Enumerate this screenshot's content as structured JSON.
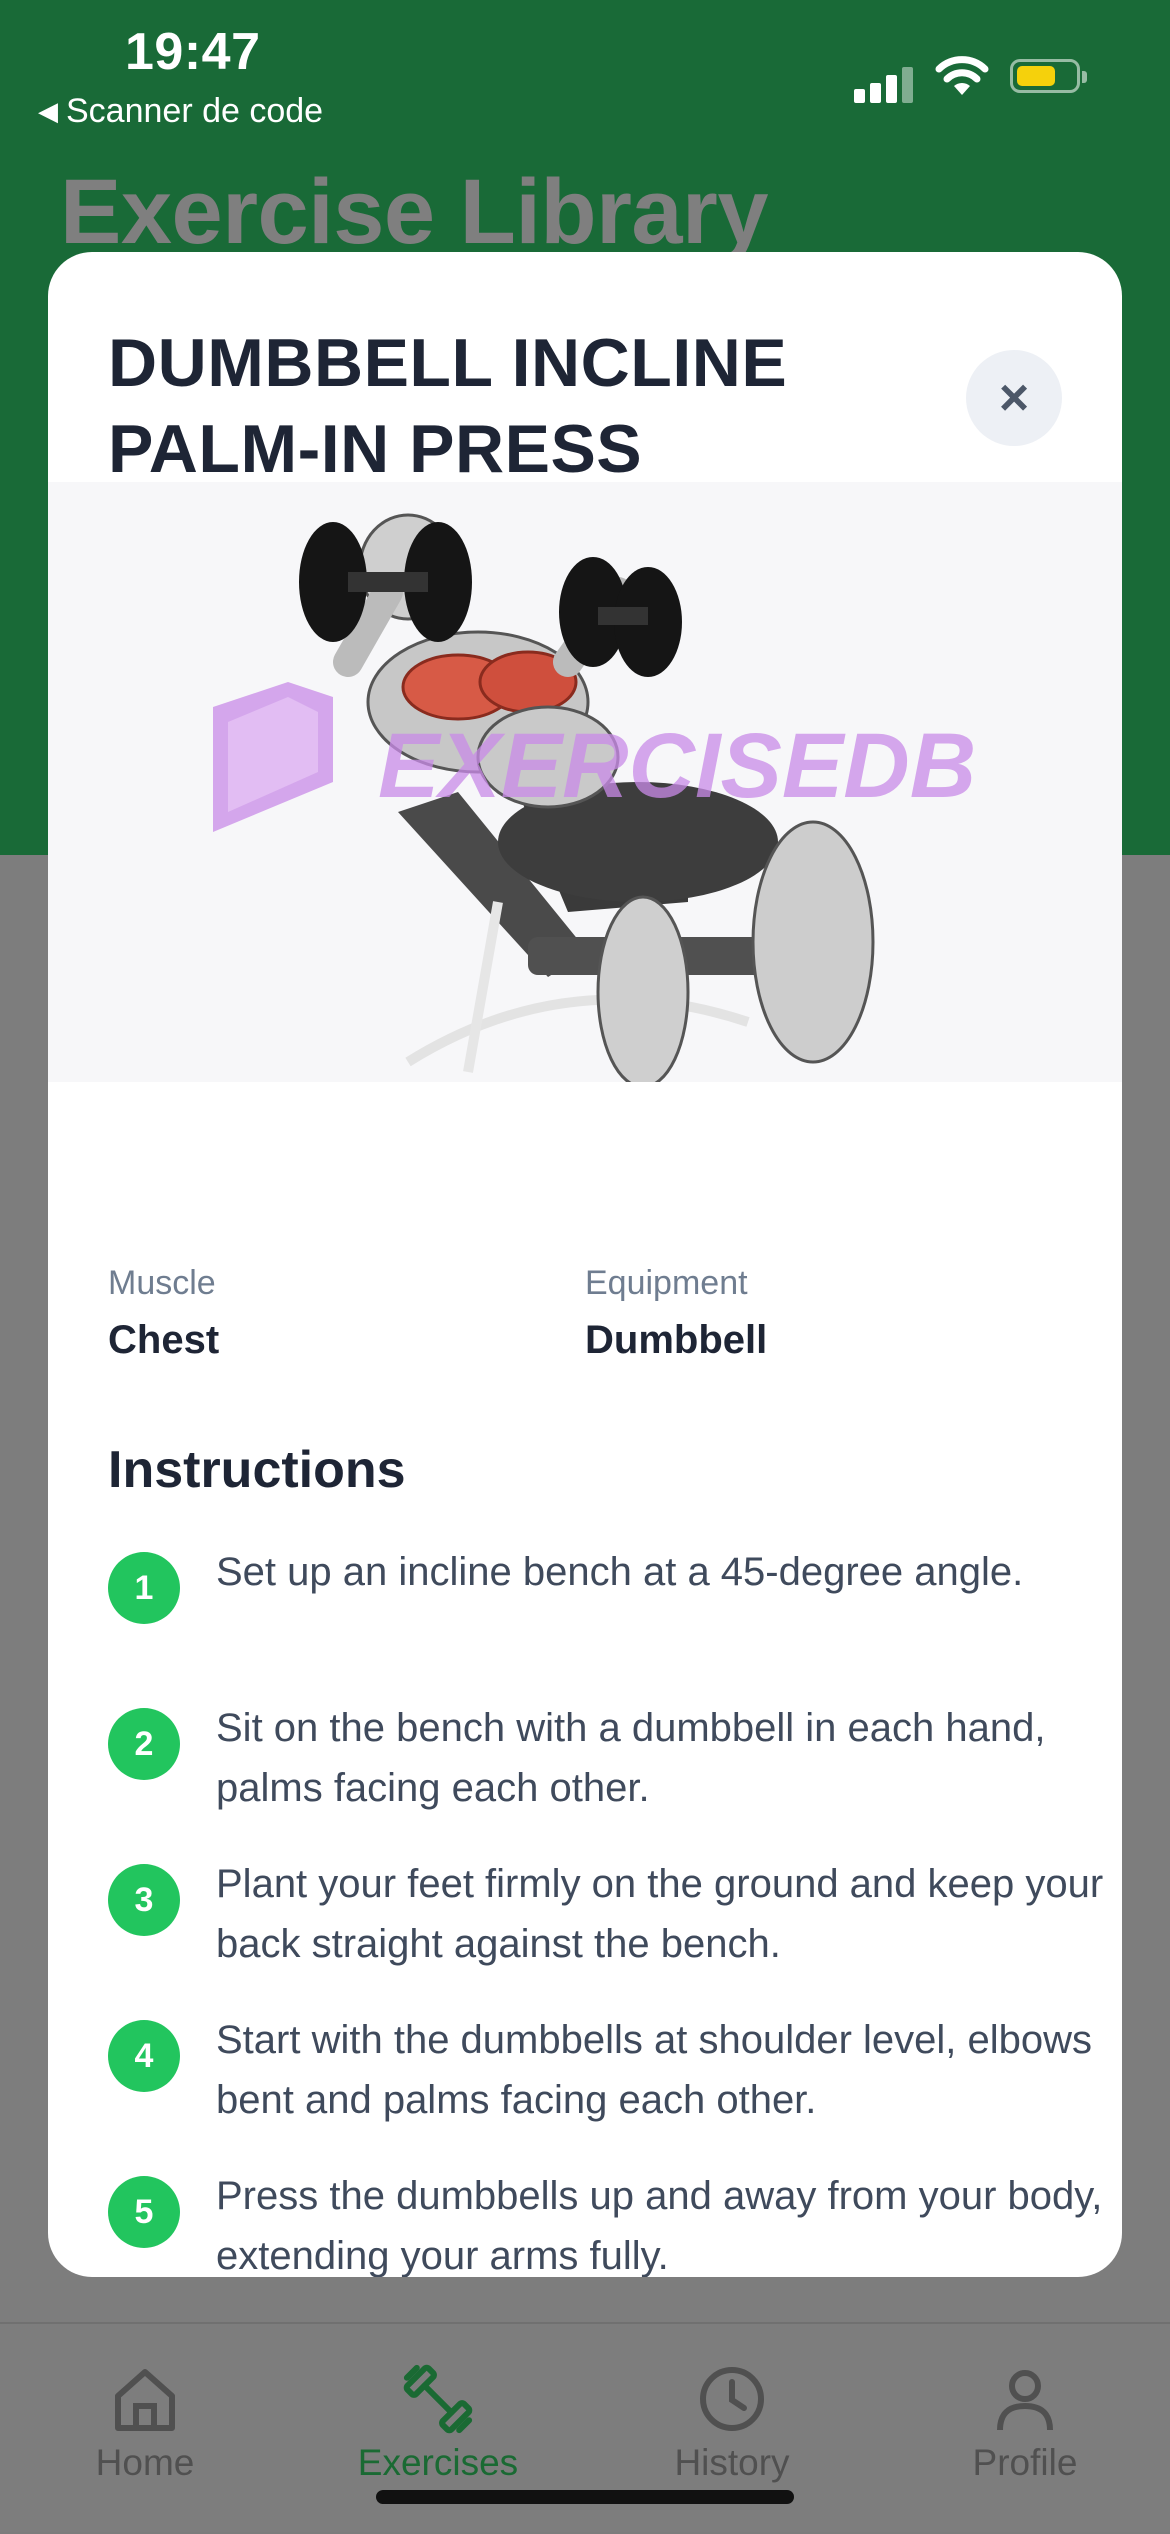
{
  "status_bar": {
    "time": "19:47",
    "back_app": "Scanner de code"
  },
  "page": {
    "title": "Exercise Library"
  },
  "modal": {
    "title_line1": "DUMBBELL INCLINE",
    "title_line2": "PALM-IN PRESS",
    "close_symbol": "×",
    "image_watermark": "EXERCISEDB",
    "muscle_label": "Muscle",
    "muscle_value": "Chest",
    "equipment_label": "Equipment",
    "equipment_value": "Dumbbell",
    "instructions_title": "Instructions",
    "steps": [
      {
        "num": "1",
        "text": "Set up an incline bench at a 45-degree angle."
      },
      {
        "num": "2",
        "text": "Sit on the bench with a dumbbell in each hand, palms facing each other."
      },
      {
        "num": "3",
        "text": "Plant your feet firmly on the ground and keep your back straight against the bench."
      },
      {
        "num": "4",
        "text": "Start with the dumbbells at shoulder level, elbows bent and palms facing each other."
      },
      {
        "num": "5",
        "text": "Press the dumbbells up and away from your body, extending your arms fully."
      }
    ]
  },
  "tabbar": {
    "tabs": [
      {
        "label": "Home",
        "icon": "home-icon"
      },
      {
        "label": "Exercises",
        "icon": "dumbbell-icon",
        "active": true
      },
      {
        "label": "History",
        "icon": "clock-icon"
      },
      {
        "label": "Profile",
        "icon": "person-icon"
      }
    ]
  },
  "colors": {
    "header_green": "#196a37",
    "accent_green": "#22c55e",
    "active_tab": "#1a6a33",
    "battery": "#f5d10c"
  }
}
